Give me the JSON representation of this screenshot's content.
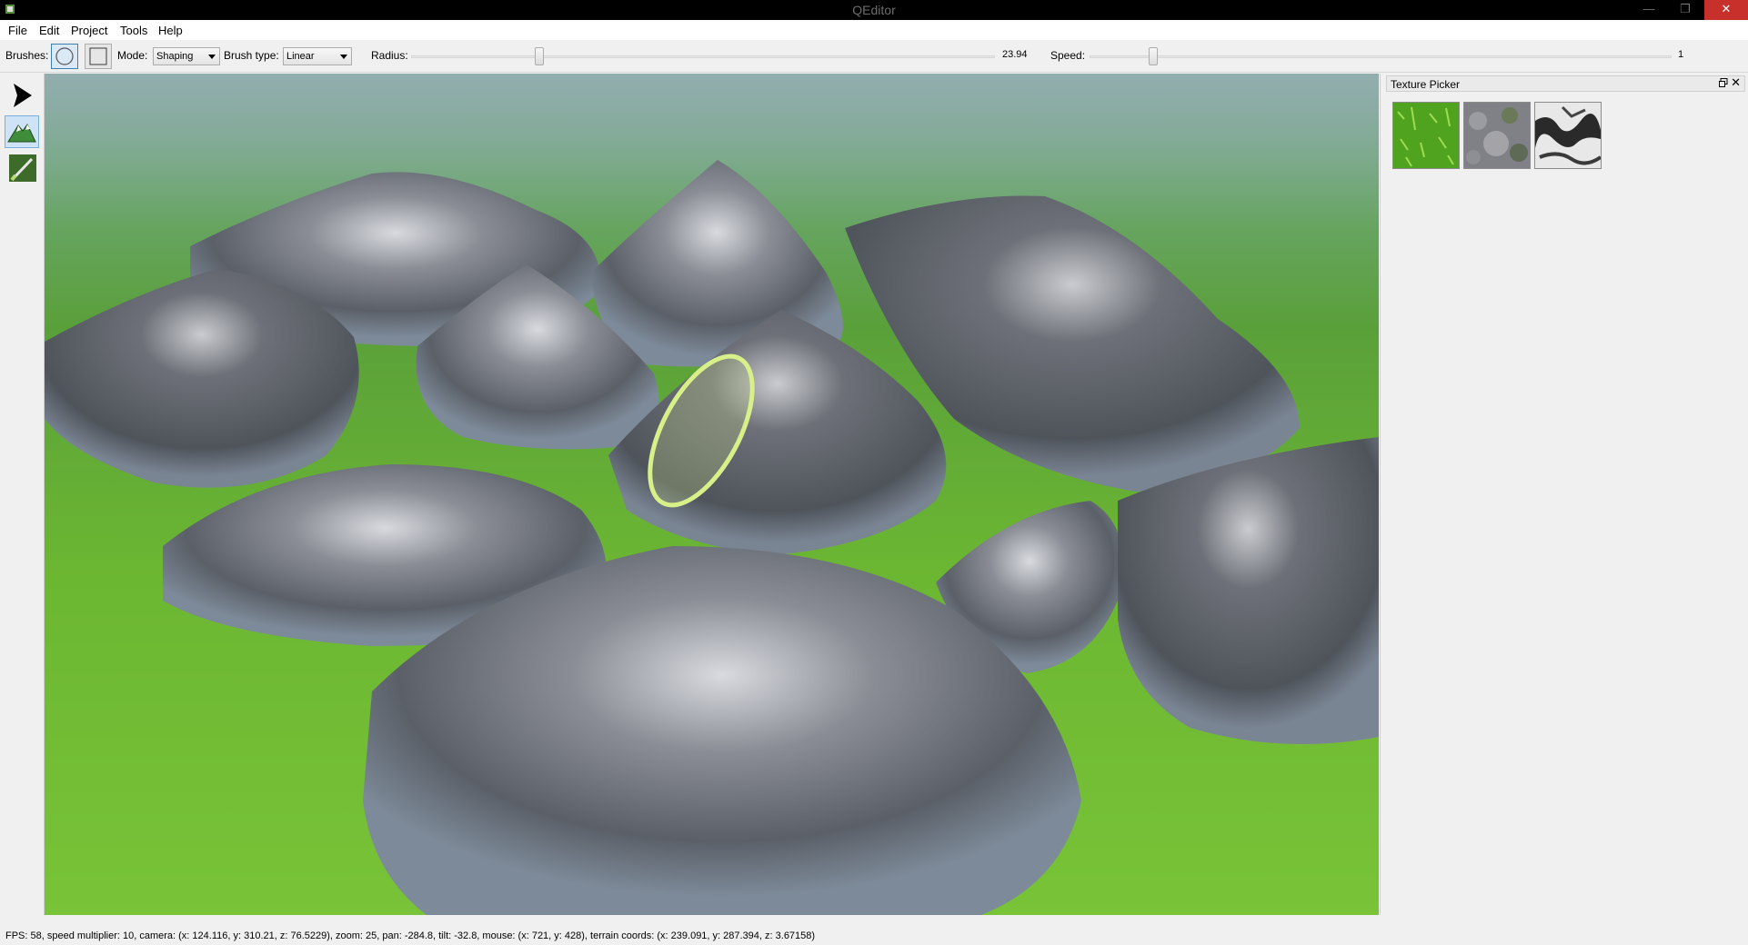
{
  "window": {
    "title": "QEditor",
    "minimize_glyph": "—",
    "maximize_glyph": "❐",
    "close_glyph": "✕"
  },
  "menu": [
    "File",
    "Edit",
    "Project",
    "Tools",
    "Help"
  ],
  "toolbar": {
    "brushes_label": "Brushes:",
    "mode_label": "Mode:",
    "mode_value": "Shaping",
    "brush_type_label": "Brush type:",
    "brush_type_value": "Linear",
    "radius_label": "Radius:",
    "radius_value": "23.94",
    "speed_label": "Speed:",
    "speed_value": "1",
    "radius_fraction": 0.22,
    "speed_fraction": 0.11,
    "brush_shapes": [
      "circle-brush-icon",
      "square-brush-icon"
    ]
  },
  "tools": [
    "select-arrow-icon",
    "terrain-sculpt-icon",
    "texture-paint-icon"
  ],
  "dock": {
    "title": "Texture Picker",
    "textures": [
      "grass-texture",
      "rock-moss-texture",
      "rock-snow-texture"
    ]
  },
  "status": {
    "text": "FPS: 58, speed multiplier: 10, camera: (x: 124.116, y: 310.21, z: 76.5229), zoom: 25, pan: -284.8, tilt: -32.8, mouse: (x: 721, y: 428), terrain coords: (x: 239.091, y: 287.394, z: 3.67158)"
  },
  "colors": {
    "accent_close": "#c7302b",
    "brush_ring": "#d8f08a",
    "grass": "#6cb732"
  }
}
